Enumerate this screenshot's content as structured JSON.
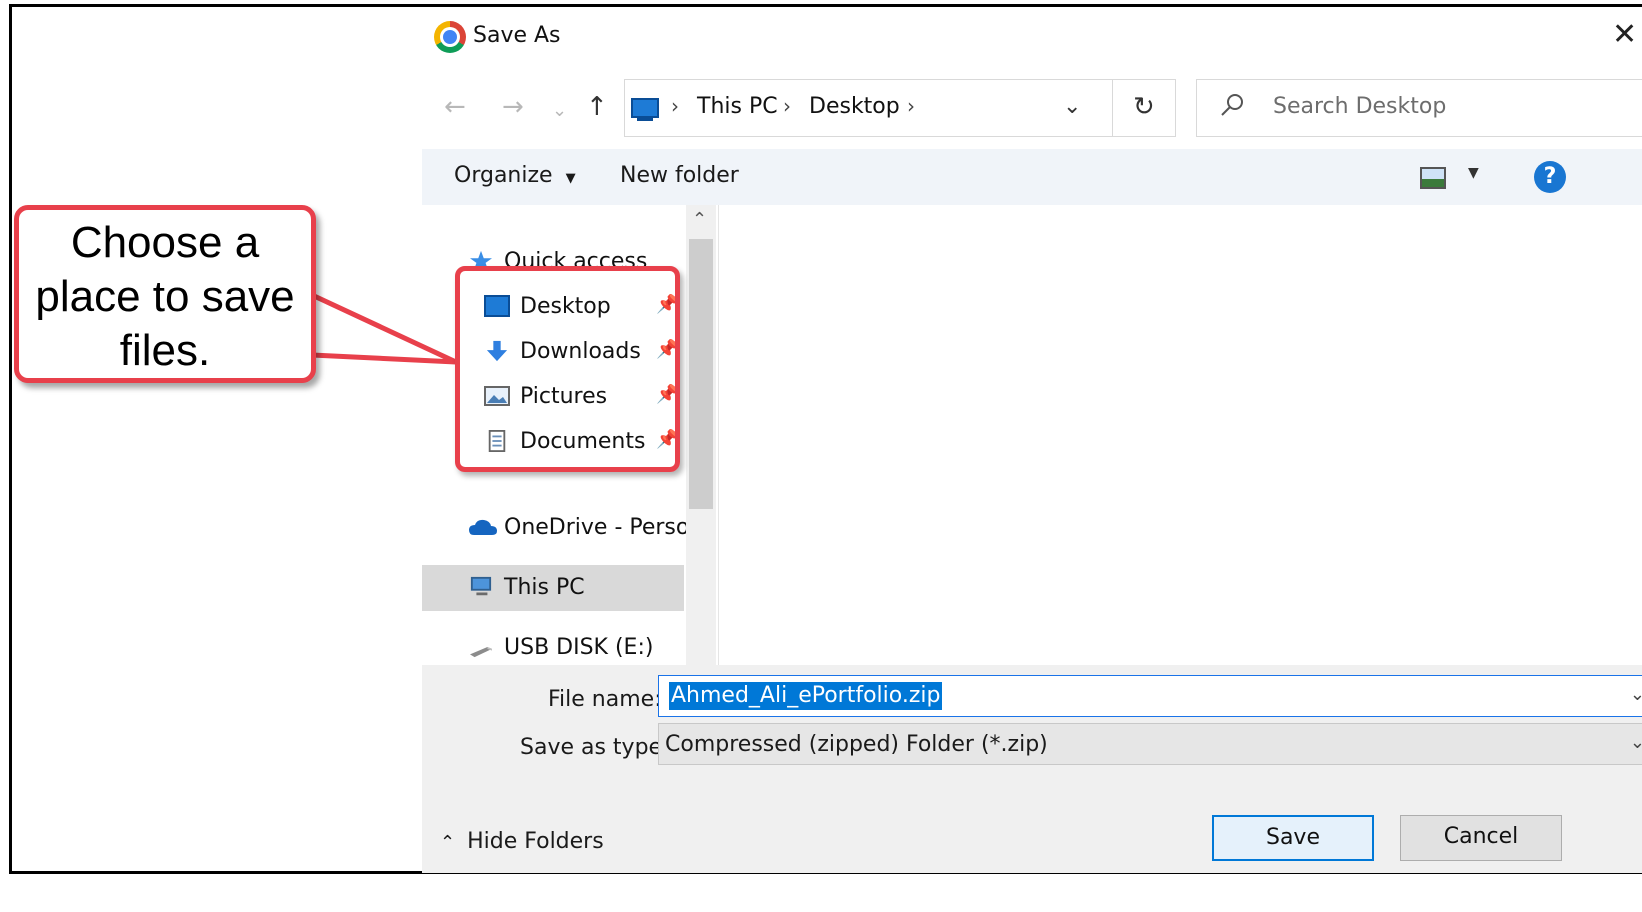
{
  "dialog": {
    "title": "Save As",
    "close_icon": "close-icon"
  },
  "nav": {
    "address": {
      "segments": [
        "This PC",
        "Desktop"
      ]
    },
    "search_placeholder": "Search Desktop"
  },
  "toolbar": {
    "organize_label": "Organize",
    "new_folder_label": "New folder",
    "help_label": "?"
  },
  "sidebar": {
    "items": [
      {
        "label": "Quick access",
        "icon": "star-icon"
      },
      {
        "label": "Desktop",
        "icon": "desktop-icon",
        "pinned": true
      },
      {
        "label": "Downloads",
        "icon": "download-arrow-icon",
        "pinned": true
      },
      {
        "label": "Pictures",
        "icon": "pictures-icon",
        "pinned": true
      },
      {
        "label": "Documents",
        "icon": "documents-icon",
        "pinned": true
      },
      {
        "label": "OneDrive - Person",
        "icon": "cloud-icon"
      },
      {
        "label": "This PC",
        "icon": "computer-icon",
        "selected": true
      },
      {
        "label": "USB DISK (E:)",
        "icon": "usb-drive-icon"
      }
    ]
  },
  "form": {
    "file_name_label": "File name:",
    "file_name_value": "Ahmed_Ali_ePortfolio.zip",
    "save_type_label": "Save as type:",
    "save_type_value": "Compressed (zipped) Folder (*.zip)"
  },
  "footer": {
    "hide_folders_label": "Hide Folders",
    "save_label": "Save",
    "cancel_label": "Cancel"
  },
  "annotation": {
    "callout_lines": [
      "Choose a",
      "place to save",
      "files."
    ],
    "color": "#e8404b"
  },
  "colors": {
    "accent": "#0078d7",
    "toolbar_bg": "#f0f4f9"
  }
}
